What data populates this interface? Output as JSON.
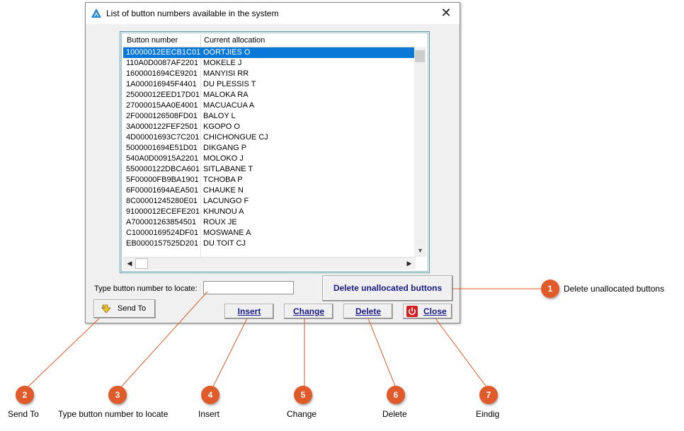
{
  "window": {
    "title": "List of button numbers available in the system",
    "close_glyph": "✕"
  },
  "list": {
    "columns": [
      "Button number",
      "Current allocation"
    ],
    "rows": [
      {
        "number": "10000012EECB1C01",
        "allocation": "OORTJIES O",
        "selected": true
      },
      {
        "number": "110A0D0087AF2201",
        "allocation": "MOKELE J"
      },
      {
        "number": "1600001694CE9201",
        "allocation": "MANYISI RR"
      },
      {
        "number": "1A000016945F4401",
        "allocation": "DU PLESSIS T"
      },
      {
        "number": "25000012EED17D01",
        "allocation": "MALOKA RA"
      },
      {
        "number": "27000015AA0E4001",
        "allocation": "MACUACUA A"
      },
      {
        "number": "2F0000126508FD01",
        "allocation": "BALOY L"
      },
      {
        "number": "3A0000122FEF2501",
        "allocation": "KGOPO O"
      },
      {
        "number": "4D00001693C7C201",
        "allocation": "CHICHONGUE CJ"
      },
      {
        "number": "5000001694E51D01",
        "allocation": "DIKGANG P"
      },
      {
        "number": "540A0D00915A2201",
        "allocation": "MOLOKO J"
      },
      {
        "number": "550000122DBCA601",
        "allocation": "SITLABANE T"
      },
      {
        "number": "5F00000FB9BA1901",
        "allocation": "TCHOBA P"
      },
      {
        "number": "6F00001694AEA501",
        "allocation": "CHAUKE N"
      },
      {
        "number": "8C00001245280E01",
        "allocation": "LACUNGO F"
      },
      {
        "number": "91000012ECEFE201",
        "allocation": "KHUNOU A"
      },
      {
        "number": "A700001263854501",
        "allocation": "ROUX JE"
      },
      {
        "number": "C10000169524DF01",
        "allocation": "MOSWANE A"
      },
      {
        "number": "EB0000157525D201",
        "allocation": "DU TOIT CJ"
      }
    ],
    "selection_color": "#0a78d7"
  },
  "controls": {
    "locate_label": "Type button number to locate:",
    "locate_value": "",
    "delete_unallocated": "Delete unallocated buttons",
    "send_to": "Send To",
    "insert": "Insert",
    "change": "Change",
    "delete": "Delete",
    "close": "Close"
  },
  "callouts": [
    {
      "num": "1",
      "text": "Delete unallocated buttons"
    },
    {
      "num": "2",
      "text": "Send To"
    },
    {
      "num": "3",
      "text": "Type button number to locate"
    },
    {
      "num": "4",
      "text": "Insert"
    },
    {
      "num": "5",
      "text": "Change"
    },
    {
      "num": "6",
      "text": "Delete"
    },
    {
      "num": "7",
      "text": "Eindig"
    }
  ],
  "colors": {
    "callout": "#e05a2a",
    "button_text": "#1a1a8a",
    "close_icon_bg": "#d42020"
  }
}
